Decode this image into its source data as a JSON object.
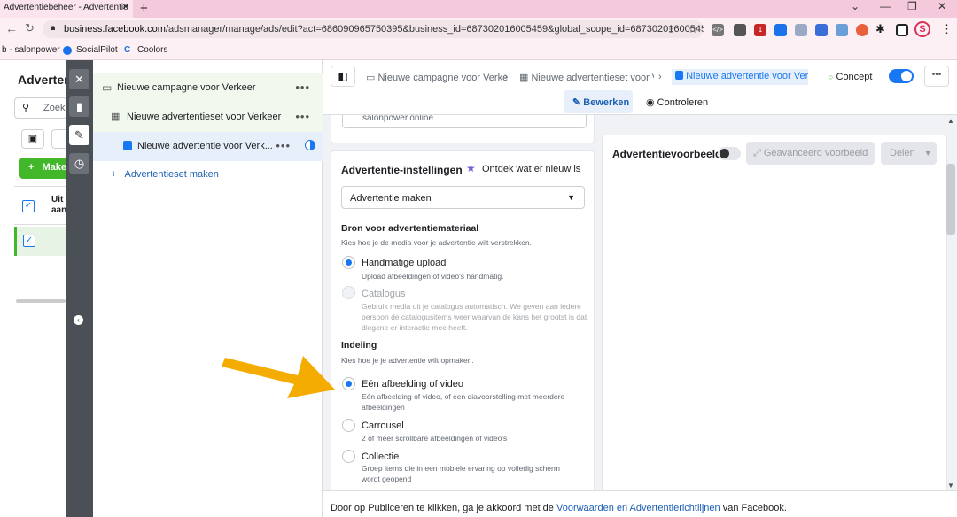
{
  "browser": {
    "tab_title": "Advertentiebeheer - Advertentie",
    "url_host": "business.facebook.com",
    "url_rest": "/adsmanager/manage/ads/edit?act=686090965750395&business_id=687302016005459&global_scope_id=687302016005459...",
    "bookmarks": [
      "b - salonpower",
      "SocialPilot",
      "Coolors"
    ],
    "profile_initial": "S",
    "ext_badge": "1"
  },
  "left": {
    "title": "Adverten",
    "search_placeholder": "Zoek",
    "create_label": "Make",
    "col_header": "Uit aan"
  },
  "tree": {
    "campaign": "Nieuwe campagne voor Verkeer",
    "adset": "Nieuwe advertentieset voor Verkeer",
    "ad": "Nieuwe advertentie voor Verk...",
    "add_adset": "Advertentieset maken",
    "dots": "•••"
  },
  "topnav": {
    "crumb_campaign": "Nieuwe campagne voor Verke",
    "crumb_adset": "Nieuwe advertentieset voor Ve",
    "crumb_ad": "Nieuwe advertentie voor Verkе",
    "status": "Concept",
    "more": "•••",
    "tab_edit": "Bewerken",
    "tab_review": "Controleren"
  },
  "settings": {
    "prev_field": "salonpower.online",
    "title": "Advertentie-instellingen",
    "whats_new": "Ontdek wat er nieuw is",
    "dropdown_value": "Advertentie maken",
    "source_title": "Bron voor advertentiemateriaal",
    "source_desc": "Kies hoe je de media voor je advertentie wilt verstrekken.",
    "manual_title": "Handmatige upload",
    "manual_desc": "Upload afbeeldingen of video's handmatig.",
    "catalog_title": "Catalogus",
    "catalog_desc": "Gebruik media uit je catalogus automatisch. We geven aan iedere persoon de catalogusitems weer waarvan de kans het grootst is dat diegene er interactie mee heeft.",
    "format_title": "Indeling",
    "format_desc": "Kies hoe je je advertentie wilt opmaken.",
    "single_title": "Eén afbeelding of video",
    "single_desc": "Eén afbeelding of video, of een diavoorstelling met meerdere afbeeldingen",
    "carousel_title": "Carrousel",
    "carousel_desc": "2 of meer scrollbare afbeeldingen of video's",
    "collection_title": "Collectie",
    "collection_desc": "Groep items die in een mobiele ervaring op volledig scherm wordt geopend"
  },
  "preview": {
    "title": "Advertentievoorbeeld",
    "advanced": "Geavanceerd voorbeeld",
    "share": "Delen"
  },
  "footer": {
    "before": "Door op Publiceren te klikken, ga je akkoord met de ",
    "link": "Voorwaarden en Advertentierichtlijnen",
    "after": " van Facebook."
  },
  "colors": {
    "accent": "#1877f2",
    "arrow": "#f5ac00",
    "green": "#42b72a"
  }
}
